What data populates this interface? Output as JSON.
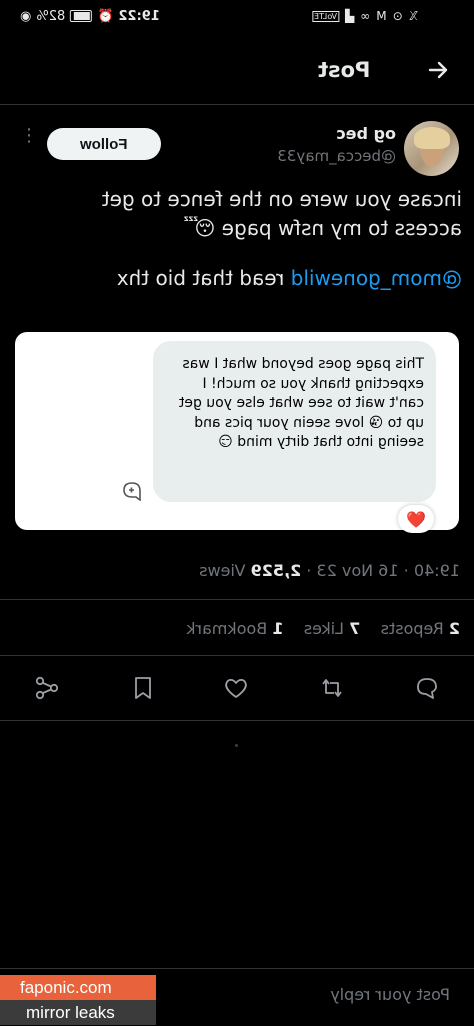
{
  "status_bar": {
    "time": "19:22",
    "battery": "82%",
    "icons": [
      "eye-icon",
      "alarm-icon",
      "battery-icon",
      "network-icon",
      "cellular-icon",
      "volte-icon",
      "infinity-icon",
      "message-icon",
      "gmail-icon",
      "x-app-icon"
    ]
  },
  "header": {
    "title": "Post",
    "back_icon": "arrow-back-icon"
  },
  "author": {
    "display_name": "og bec",
    "handle": "@becca_may33",
    "follow_label": "Follow"
  },
  "post": {
    "line1": "incase you were on the fence to get",
    "line2": "access to my nsfw page 😴",
    "mention": "@mom_gonewild",
    "after_mention": " read that bio thx"
  },
  "quoted": {
    "message": "This page goes beyond what I was expecting thank you so much! I can't wait to see what else you get up to 😘 love seein your pics and seeing into that dirty mind 😏",
    "reaction": "❤️"
  },
  "meta": {
    "time": "19:40",
    "date": "16 Nov 23",
    "views_count": "2,529",
    "views_label": "Views",
    "separator": "·"
  },
  "stats": {
    "reposts_count": "2",
    "reposts_label": "Reposts",
    "likes_count": "7",
    "likes_label": "Likes",
    "bookmarks_count": "1",
    "bookmarks_label": "Bookmark"
  },
  "reply": {
    "placeholder": "Post your reply"
  },
  "watermark": {
    "line1": "faponic.com",
    "line2": "mirror leaks",
    "accent": "#e8623b"
  },
  "colors": {
    "link": "#1d9bf0",
    "muted": "#71767b",
    "background": "#000000",
    "divider": "#2f3336"
  }
}
